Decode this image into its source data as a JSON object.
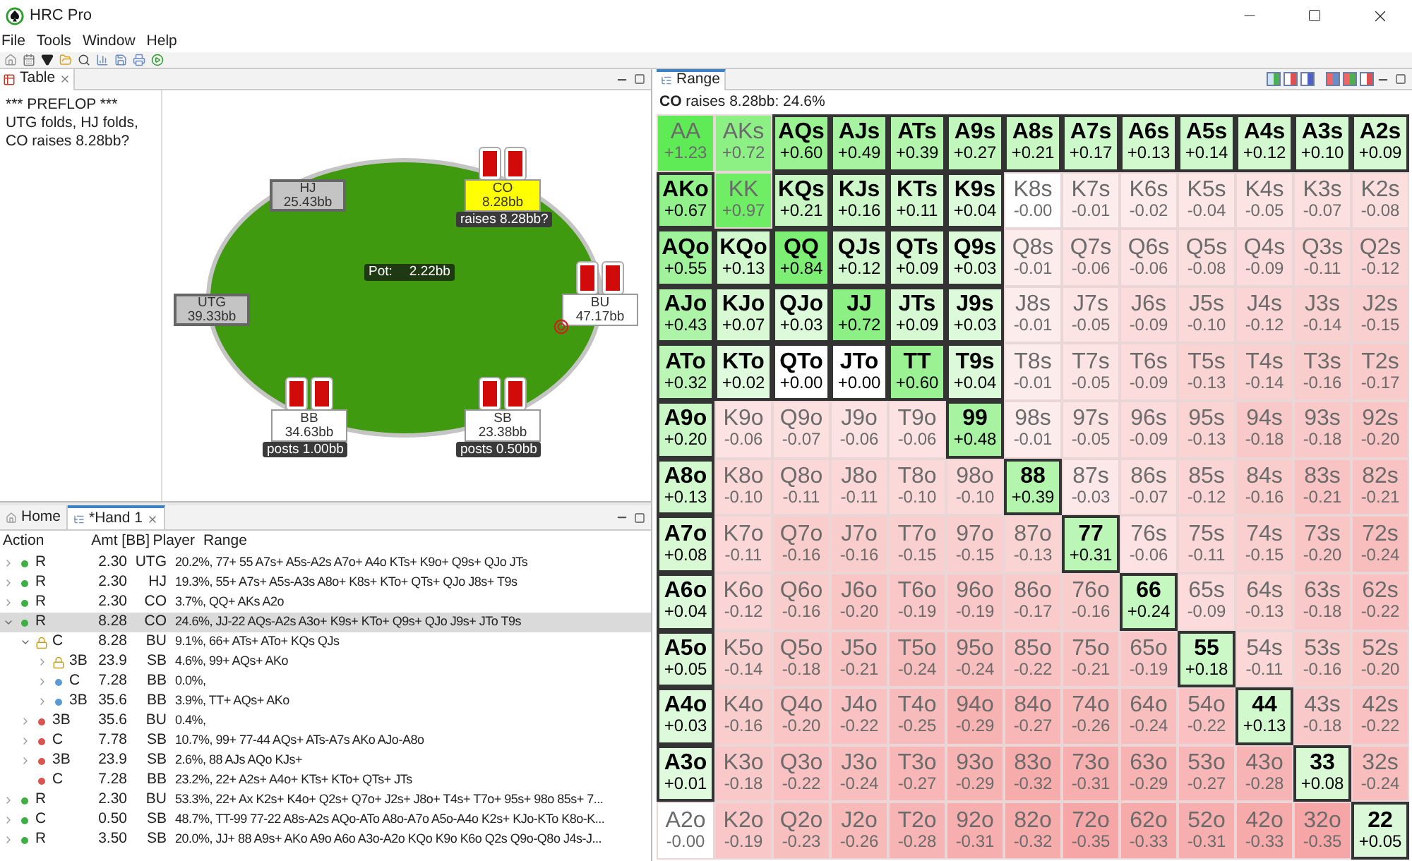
{
  "window": {
    "title": "HRC Pro"
  },
  "menu": [
    "File",
    "Tools",
    "Window",
    "Help"
  ],
  "table_view": {
    "tab": {
      "label": "Table",
      "closable": true,
      "selected": true
    },
    "log": [
      "*** PREFLOP ***",
      "UTG folds, HJ folds, CO raises 8.28bb?"
    ],
    "pot": {
      "label": "Pot:",
      "amount": "2.22bb"
    },
    "seats": [
      {
        "position": "HJ",
        "stack": "25.43bb",
        "folded": true,
        "acting": false,
        "cards": false,
        "dealer": false
      },
      {
        "position": "CO",
        "stack": "8.28bb",
        "folded": false,
        "acting": true,
        "cards": true,
        "dealer": false,
        "action": "raises 8.28bb?"
      },
      {
        "position": "UTG",
        "stack": "39.33bb",
        "folded": true,
        "acting": false,
        "cards": false,
        "dealer": false
      },
      {
        "position": "BU",
        "stack": "47.17bb",
        "folded": false,
        "acting": false,
        "cards": true,
        "dealer": true
      },
      {
        "position": "BB",
        "stack": "34.63bb",
        "folded": false,
        "acting": false,
        "cards": true,
        "dealer": false,
        "action": "posts 1.00bb"
      },
      {
        "position": "SB",
        "stack": "23.38bb",
        "folded": false,
        "acting": false,
        "cards": true,
        "dealer": false,
        "action": "posts 0.50bb"
      }
    ]
  },
  "hand_view": {
    "tabs": [
      {
        "label": "Home",
        "selected": false,
        "closable": false
      },
      {
        "label": "*Hand 1",
        "selected": true,
        "closable": true
      }
    ],
    "columns": [
      "Action",
      "Amt [BB]",
      "Player",
      "Range"
    ],
    "rows": [
      {
        "action": "R",
        "amount": "2.30",
        "player": "UTG",
        "range": "20.2%, 77+ 55 A7s+ A5s-A2s A7o+ A4o KTs+ K9o+ Q9s+ QJo JTs",
        "locked": false,
        "color": "#3cb043",
        "expandable": true,
        "expanded": false,
        "selected": false
      },
      {
        "action": "R",
        "amount": "2.30",
        "player": "HJ",
        "range": "19.3%, 55+ A7s+ A5s-A3s A8o+ K8s+ KTo+ QTs+ QJo J8s+ T9s",
        "locked": false,
        "color": "#3cb043",
        "expandable": true,
        "expanded": false,
        "selected": false
      },
      {
        "action": "R",
        "amount": "2.30",
        "player": "CO",
        "range": "3.7%, QQ+ AKs A2o",
        "locked": false,
        "color": "#3cb043",
        "expandable": true,
        "expanded": false,
        "selected": false
      },
      {
        "action": "R",
        "amount": "8.28",
        "player": "CO",
        "range": "24.6%, JJ-22 AQs-A2s A3o+ K9s+ KTo+ Q9s+ QJo J9s+ JTo T9s",
        "locked": false,
        "color": "#3cb043",
        "expandable": true,
        "expanded": true,
        "selected": true,
        "children": [
          {
            "action": "C",
            "amount": "8.28",
            "player": "BU",
            "range": "9.1%, 66+ ATs+ ATo+ KQs QJs",
            "locked": true,
            "expandable": true,
            "expanded": true,
            "selected": false,
            "children": [
              {
                "action": "3B",
                "amount": "23.9",
                "player": "SB",
                "range": "4.6%, 99+ AQs+ AKo",
                "locked": true,
                "expandable": true,
                "expanded": false,
                "selected": false
              },
              {
                "action": "C",
                "amount": "7.28",
                "player": "BB",
                "range": "0.0%,",
                "locked": false,
                "color": "#5b9bd5",
                "expandable": true,
                "expanded": false,
                "selected": false
              },
              {
                "action": "3B",
                "amount": "35.6",
                "player": "BB",
                "range": "3.9%, TT+ AQs+ AKo",
                "locked": false,
                "color": "#5b9bd5",
                "expandable": true,
                "expanded": false,
                "selected": false
              }
            ]
          },
          {
            "action": "3B",
            "amount": "35.6",
            "player": "BU",
            "range": "0.4%,",
            "locked": false,
            "color": "#d9534f",
            "expandable": true,
            "expanded": false,
            "selected": false
          },
          {
            "action": "C",
            "amount": "7.78",
            "player": "SB",
            "range": "10.7%, 99+ 77-44 AQs+ ATs-A7s AKo AJo-A8o",
            "locked": false,
            "color": "#d9534f",
            "expandable": true,
            "expanded": false,
            "selected": false
          },
          {
            "action": "3B",
            "amount": "23.9",
            "player": "SB",
            "range": "2.6%, 88 AJs AQo KJs+",
            "locked": false,
            "color": "#d9534f",
            "expandable": true,
            "expanded": false,
            "selected": false
          },
          {
            "action": "C",
            "amount": "7.28",
            "player": "BB",
            "range": "23.2%, 22+ A2s+ A4o+ KTs+ KTo+ QTs+ JTs",
            "locked": false,
            "color": "#d9534f",
            "expandable": false,
            "expanded": false,
            "selected": false
          }
        ]
      },
      {
        "action": "R",
        "amount": "2.30",
        "player": "BU",
        "range": "53.3%, 22+ Ax K2s+ K4o+ Q2s+ Q7o+ J2s+ J8o+ T4s+ T7o+ 95s+ 98o 85s+ 7...",
        "locked": false,
        "color": "#3cb043",
        "expandable": true,
        "expanded": false,
        "selected": false
      },
      {
        "action": "C",
        "amount": "0.50",
        "player": "SB",
        "range": "48.7%, TT-99 77-22 A8s-A2s AQo-ATo A8o-A7o A5o-A4o K2s+ KJo-KTo K8o-K...",
        "locked": false,
        "color": "#3cb043",
        "expandable": true,
        "expanded": false,
        "selected": false
      },
      {
        "action": "R",
        "amount": "3.50",
        "player": "SB",
        "range": "20.0%, JJ+ 88 A9s+ AKo A9o A6o A3o-A2o KQo K9o K6o Q2s Q9o-Q8o J4s-J...",
        "locked": false,
        "color": "#3cb043",
        "expandable": true,
        "expanded": false,
        "selected": false
      }
    ]
  },
  "range_view": {
    "tab": {
      "label": "Range",
      "selected": true
    },
    "subtitle": "**CO** raises 8.28bb: 24.6%",
    "grid": [
      [
        {
          "hand": "AA",
          "ev": "+1.23",
          "in_range": false
        },
        {
          "hand": "AKs",
          "ev": "+0.72",
          "in_range": false
        },
        {
          "hand": "AQs",
          "ev": "+0.60",
          "in_range": true
        },
        {
          "hand": "AJs",
          "ev": "+0.49",
          "in_range": true
        },
        {
          "hand": "ATs",
          "ev": "+0.39",
          "in_range": true
        },
        {
          "hand": "A9s",
          "ev": "+0.27",
          "in_range": true
        },
        {
          "hand": "A8s",
          "ev": "+0.21",
          "in_range": true
        },
        {
          "hand": "A7s",
          "ev": "+0.17",
          "in_range": true
        },
        {
          "hand": "A6s",
          "ev": "+0.13",
          "in_range": true
        },
        {
          "hand": "A5s",
          "ev": "+0.14",
          "in_range": true
        },
        {
          "hand": "A4s",
          "ev": "+0.12",
          "in_range": true
        },
        {
          "hand": "A3s",
          "ev": "+0.10",
          "in_range": true
        },
        {
          "hand": "A2s",
          "ev": "+0.09",
          "in_range": true
        }
      ],
      [
        {
          "hand": "AKo",
          "ev": "+0.67",
          "in_range": true
        },
        {
          "hand": "KK",
          "ev": "+0.97",
          "in_range": false
        },
        {
          "hand": "KQs",
          "ev": "+0.21",
          "in_range": true
        },
        {
          "hand": "KJs",
          "ev": "+0.16",
          "in_range": true
        },
        {
          "hand": "KTs",
          "ev": "+0.11",
          "in_range": true
        },
        {
          "hand": "K9s",
          "ev": "+0.04",
          "in_range": true
        },
        {
          "hand": "K8s",
          "ev": "-0.00",
          "in_range": false
        },
        {
          "hand": "K7s",
          "ev": "-0.01",
          "in_range": false
        },
        {
          "hand": "K6s",
          "ev": "-0.02",
          "in_range": false
        },
        {
          "hand": "K5s",
          "ev": "-0.04",
          "in_range": false
        },
        {
          "hand": "K4s",
          "ev": "-0.05",
          "in_range": false
        },
        {
          "hand": "K3s",
          "ev": "-0.07",
          "in_range": false
        },
        {
          "hand": "K2s",
          "ev": "-0.08",
          "in_range": false
        }
      ],
      [
        {
          "hand": "AQo",
          "ev": "+0.55",
          "in_range": true
        },
        {
          "hand": "KQo",
          "ev": "+0.13",
          "in_range": true
        },
        {
          "hand": "QQ",
          "ev": "+0.84",
          "in_range": true
        },
        {
          "hand": "QJs",
          "ev": "+0.12",
          "in_range": true
        },
        {
          "hand": "QTs",
          "ev": "+0.09",
          "in_range": true
        },
        {
          "hand": "Q9s",
          "ev": "+0.03",
          "in_range": true
        },
        {
          "hand": "Q8s",
          "ev": "-0.01",
          "in_range": false
        },
        {
          "hand": "Q7s",
          "ev": "-0.06",
          "in_range": false
        },
        {
          "hand": "Q6s",
          "ev": "-0.06",
          "in_range": false
        },
        {
          "hand": "Q5s",
          "ev": "-0.08",
          "in_range": false
        },
        {
          "hand": "Q4s",
          "ev": "-0.09",
          "in_range": false
        },
        {
          "hand": "Q3s",
          "ev": "-0.11",
          "in_range": false
        },
        {
          "hand": "Q2s",
          "ev": "-0.12",
          "in_range": false
        }
      ],
      [
        {
          "hand": "AJo",
          "ev": "+0.43",
          "in_range": true
        },
        {
          "hand": "KJo",
          "ev": "+0.07",
          "in_range": true
        },
        {
          "hand": "QJo",
          "ev": "+0.03",
          "in_range": true
        },
        {
          "hand": "JJ",
          "ev": "+0.72",
          "in_range": true
        },
        {
          "hand": "JTs",
          "ev": "+0.09",
          "in_range": true
        },
        {
          "hand": "J9s",
          "ev": "+0.03",
          "in_range": true
        },
        {
          "hand": "J8s",
          "ev": "-0.01",
          "in_range": false
        },
        {
          "hand": "J7s",
          "ev": "-0.05",
          "in_range": false
        },
        {
          "hand": "J6s",
          "ev": "-0.09",
          "in_range": false
        },
        {
          "hand": "J5s",
          "ev": "-0.10",
          "in_range": false
        },
        {
          "hand": "J4s",
          "ev": "-0.12",
          "in_range": false
        },
        {
          "hand": "J3s",
          "ev": "-0.14",
          "in_range": false
        },
        {
          "hand": "J2s",
          "ev": "-0.15",
          "in_range": false
        }
      ],
      [
        {
          "hand": "ATo",
          "ev": "+0.32",
          "in_range": true
        },
        {
          "hand": "KTo",
          "ev": "+0.02",
          "in_range": true
        },
        {
          "hand": "QTo",
          "ev": "+0.00",
          "in_range": true
        },
        {
          "hand": "JTo",
          "ev": "+0.00",
          "in_range": true
        },
        {
          "hand": "TT",
          "ev": "+0.60",
          "in_range": true
        },
        {
          "hand": "T9s",
          "ev": "+0.04",
          "in_range": true
        },
        {
          "hand": "T8s",
          "ev": "-0.01",
          "in_range": false
        },
        {
          "hand": "T7s",
          "ev": "-0.05",
          "in_range": false
        },
        {
          "hand": "T6s",
          "ev": "-0.09",
          "in_range": false
        },
        {
          "hand": "T5s",
          "ev": "-0.13",
          "in_range": false
        },
        {
          "hand": "T4s",
          "ev": "-0.14",
          "in_range": false
        },
        {
          "hand": "T3s",
          "ev": "-0.16",
          "in_range": false
        },
        {
          "hand": "T2s",
          "ev": "-0.17",
          "in_range": false
        }
      ],
      [
        {
          "hand": "A9o",
          "ev": "+0.20",
          "in_range": true
        },
        {
          "hand": "K9o",
          "ev": "-0.06",
          "in_range": false
        },
        {
          "hand": "Q9o",
          "ev": "-0.07",
          "in_range": false
        },
        {
          "hand": "J9o",
          "ev": "-0.06",
          "in_range": false
        },
        {
          "hand": "T9o",
          "ev": "-0.06",
          "in_range": false
        },
        {
          "hand": "99",
          "ev": "+0.48",
          "in_range": true
        },
        {
          "hand": "98s",
          "ev": "-0.01",
          "in_range": false
        },
        {
          "hand": "97s",
          "ev": "-0.05",
          "in_range": false
        },
        {
          "hand": "96s",
          "ev": "-0.09",
          "in_range": false
        },
        {
          "hand": "95s",
          "ev": "-0.13",
          "in_range": false
        },
        {
          "hand": "94s",
          "ev": "-0.18",
          "in_range": false
        },
        {
          "hand": "93s",
          "ev": "-0.18",
          "in_range": false
        },
        {
          "hand": "92s",
          "ev": "-0.20",
          "in_range": false
        }
      ],
      [
        {
          "hand": "A8o",
          "ev": "+0.13",
          "in_range": true
        },
        {
          "hand": "K8o",
          "ev": "-0.10",
          "in_range": false
        },
        {
          "hand": "Q8o",
          "ev": "-0.11",
          "in_range": false
        },
        {
          "hand": "J8o",
          "ev": "-0.11",
          "in_range": false
        },
        {
          "hand": "T8o",
          "ev": "-0.10",
          "in_range": false
        },
        {
          "hand": "98o",
          "ev": "-0.10",
          "in_range": false
        },
        {
          "hand": "88",
          "ev": "+0.39",
          "in_range": true
        },
        {
          "hand": "87s",
          "ev": "-0.03",
          "in_range": false
        },
        {
          "hand": "86s",
          "ev": "-0.07",
          "in_range": false
        },
        {
          "hand": "85s",
          "ev": "-0.12",
          "in_range": false
        },
        {
          "hand": "84s",
          "ev": "-0.16",
          "in_range": false
        },
        {
          "hand": "83s",
          "ev": "-0.21",
          "in_range": false
        },
        {
          "hand": "82s",
          "ev": "-0.21",
          "in_range": false
        }
      ],
      [
        {
          "hand": "A7o",
          "ev": "+0.08",
          "in_range": true
        },
        {
          "hand": "K7o",
          "ev": "-0.11",
          "in_range": false
        },
        {
          "hand": "Q7o",
          "ev": "-0.16",
          "in_range": false
        },
        {
          "hand": "J7o",
          "ev": "-0.16",
          "in_range": false
        },
        {
          "hand": "T7o",
          "ev": "-0.15",
          "in_range": false
        },
        {
          "hand": "97o",
          "ev": "-0.15",
          "in_range": false
        },
        {
          "hand": "87o",
          "ev": "-0.13",
          "in_range": false
        },
        {
          "hand": "77",
          "ev": "+0.31",
          "in_range": true
        },
        {
          "hand": "76s",
          "ev": "-0.06",
          "in_range": false
        },
        {
          "hand": "75s",
          "ev": "-0.11",
          "in_range": false
        },
        {
          "hand": "74s",
          "ev": "-0.15",
          "in_range": false
        },
        {
          "hand": "73s",
          "ev": "-0.20",
          "in_range": false
        },
        {
          "hand": "72s",
          "ev": "-0.24",
          "in_range": false
        }
      ],
      [
        {
          "hand": "A6o",
          "ev": "+0.04",
          "in_range": true
        },
        {
          "hand": "K6o",
          "ev": "-0.12",
          "in_range": false
        },
        {
          "hand": "Q6o",
          "ev": "-0.16",
          "in_range": false
        },
        {
          "hand": "J6o",
          "ev": "-0.20",
          "in_range": false
        },
        {
          "hand": "T6o",
          "ev": "-0.19",
          "in_range": false
        },
        {
          "hand": "96o",
          "ev": "-0.19",
          "in_range": false
        },
        {
          "hand": "86o",
          "ev": "-0.17",
          "in_range": false
        },
        {
          "hand": "76o",
          "ev": "-0.16",
          "in_range": false
        },
        {
          "hand": "66",
          "ev": "+0.24",
          "in_range": true
        },
        {
          "hand": "65s",
          "ev": "-0.09",
          "in_range": false
        },
        {
          "hand": "64s",
          "ev": "-0.13",
          "in_range": false
        },
        {
          "hand": "63s",
          "ev": "-0.18",
          "in_range": false
        },
        {
          "hand": "62s",
          "ev": "-0.22",
          "in_range": false
        }
      ],
      [
        {
          "hand": "A5o",
          "ev": "+0.05",
          "in_range": true
        },
        {
          "hand": "K5o",
          "ev": "-0.14",
          "in_range": false
        },
        {
          "hand": "Q5o",
          "ev": "-0.18",
          "in_range": false
        },
        {
          "hand": "J5o",
          "ev": "-0.21",
          "in_range": false
        },
        {
          "hand": "T5o",
          "ev": "-0.24",
          "in_range": false
        },
        {
          "hand": "95o",
          "ev": "-0.24",
          "in_range": false
        },
        {
          "hand": "85o",
          "ev": "-0.22",
          "in_range": false
        },
        {
          "hand": "75o",
          "ev": "-0.21",
          "in_range": false
        },
        {
          "hand": "65o",
          "ev": "-0.19",
          "in_range": false
        },
        {
          "hand": "55",
          "ev": "+0.18",
          "in_range": true
        },
        {
          "hand": "54s",
          "ev": "-0.11",
          "in_range": false
        },
        {
          "hand": "53s",
          "ev": "-0.16",
          "in_range": false
        },
        {
          "hand": "52s",
          "ev": "-0.20",
          "in_range": false
        }
      ],
      [
        {
          "hand": "A4o",
          "ev": "+0.03",
          "in_range": true
        },
        {
          "hand": "K4o",
          "ev": "-0.16",
          "in_range": false
        },
        {
          "hand": "Q4o",
          "ev": "-0.20",
          "in_range": false
        },
        {
          "hand": "J4o",
          "ev": "-0.22",
          "in_range": false
        },
        {
          "hand": "T4o",
          "ev": "-0.25",
          "in_range": false
        },
        {
          "hand": "94o",
          "ev": "-0.29",
          "in_range": false
        },
        {
          "hand": "84o",
          "ev": "-0.27",
          "in_range": false
        },
        {
          "hand": "74o",
          "ev": "-0.26",
          "in_range": false
        },
        {
          "hand": "64o",
          "ev": "-0.24",
          "in_range": false
        },
        {
          "hand": "54o",
          "ev": "-0.22",
          "in_range": false
        },
        {
          "hand": "44",
          "ev": "+0.13",
          "in_range": true
        },
        {
          "hand": "43s",
          "ev": "-0.18",
          "in_range": false
        },
        {
          "hand": "42s",
          "ev": "-0.22",
          "in_range": false
        }
      ],
      [
        {
          "hand": "A3o",
          "ev": "+0.01",
          "in_range": true
        },
        {
          "hand": "K3o",
          "ev": "-0.18",
          "in_range": false
        },
        {
          "hand": "Q3o",
          "ev": "-0.22",
          "in_range": false
        },
        {
          "hand": "J3o",
          "ev": "-0.24",
          "in_range": false
        },
        {
          "hand": "T3o",
          "ev": "-0.27",
          "in_range": false
        },
        {
          "hand": "93o",
          "ev": "-0.29",
          "in_range": false
        },
        {
          "hand": "83o",
          "ev": "-0.32",
          "in_range": false
        },
        {
          "hand": "73o",
          "ev": "-0.31",
          "in_range": false
        },
        {
          "hand": "63o",
          "ev": "-0.29",
          "in_range": false
        },
        {
          "hand": "53o",
          "ev": "-0.27",
          "in_range": false
        },
        {
          "hand": "43o",
          "ev": "-0.28",
          "in_range": false
        },
        {
          "hand": "33",
          "ev": "+0.08",
          "in_range": true
        },
        {
          "hand": "32s",
          "ev": "-0.24",
          "in_range": false
        }
      ],
      [
        {
          "hand": "A2o",
          "ev": "-0.00",
          "in_range": false
        },
        {
          "hand": "K2o",
          "ev": "-0.19",
          "in_range": false
        },
        {
          "hand": "Q2o",
          "ev": "-0.23",
          "in_range": false
        },
        {
          "hand": "J2o",
          "ev": "-0.26",
          "in_range": false
        },
        {
          "hand": "T2o",
          "ev": "-0.28",
          "in_range": false
        },
        {
          "hand": "92o",
          "ev": "-0.31",
          "in_range": false
        },
        {
          "hand": "82o",
          "ev": "-0.32",
          "in_range": false
        },
        {
          "hand": "72o",
          "ev": "-0.35",
          "in_range": false
        },
        {
          "hand": "62o",
          "ev": "-0.33",
          "in_range": false
        },
        {
          "hand": "52o",
          "ev": "-0.31",
          "in_range": false
        },
        {
          "hand": "42o",
          "ev": "-0.33",
          "in_range": false
        },
        {
          "hand": "32o",
          "ev": "-0.35",
          "in_range": false
        },
        {
          "hand": "22",
          "ev": "+0.05",
          "in_range": true
        }
      ]
    ]
  }
}
